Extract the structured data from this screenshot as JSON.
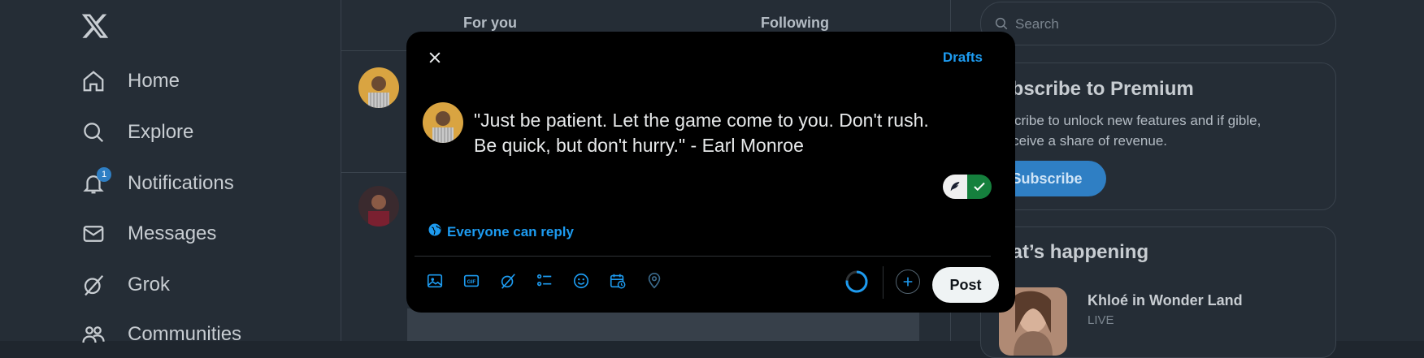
{
  "nav": {
    "items": [
      {
        "label": "Home",
        "icon": "home-icon"
      },
      {
        "label": "Explore",
        "icon": "search-icon"
      },
      {
        "label": "Notifications",
        "icon": "bell-icon",
        "badge": "1"
      },
      {
        "label": "Messages",
        "icon": "envelope-icon"
      },
      {
        "label": "Grok",
        "icon": "grok-icon"
      },
      {
        "label": "Communities",
        "icon": "people-icon"
      }
    ]
  },
  "timeline": {
    "tabs": [
      "For you",
      "Following"
    ]
  },
  "search": {
    "placeholder": "Search"
  },
  "premium": {
    "title": "ubscribe to Premium",
    "desc": "bscribe to unlock new features and if gible, receive a share of revenue.",
    "button": "Subscribe"
  },
  "happening": {
    "title": "hat’s happening",
    "trend_title": "Khloé in Wonder Land",
    "trend_sub": "LIVE"
  },
  "composer": {
    "drafts": "Drafts",
    "text": "\"Just be patient. Let the game come to you. Don't rush.\nBe quick, but don't hurry.\" - Earl Monroe",
    "reply_setting": "Everyone can reply",
    "post_button": "Post",
    "tools": [
      "image-icon",
      "gif-icon",
      "grok-icon",
      "poll-icon",
      "emoji-icon",
      "schedule-icon",
      "location-icon"
    ]
  },
  "colors": {
    "accent": "#1d9bf0",
    "modal_bg": "#000000",
    "page_bg": "#252d36"
  }
}
